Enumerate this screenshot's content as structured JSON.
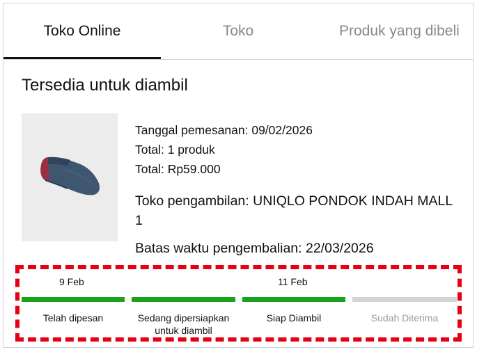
{
  "tabs": [
    {
      "label": "Toko Online",
      "active": true
    },
    {
      "label": "Toko",
      "active": false
    },
    {
      "label": "Produk yang dibeli",
      "active": false
    }
  ],
  "order": {
    "status_heading": "Tersedia untuk diambil",
    "product_image": "sock-product-image",
    "order_date": "Tanggal pemesanan: 09/02/2026",
    "total_items": "Total: 1 produk",
    "total_price": "Total: Rp59.000",
    "pickup_store": "Toko pengambilan: UNIQLO PONDOK INDAH MALL 1",
    "return_deadline": "Batas waktu pengembalian: 22/03/2026"
  },
  "progress": {
    "steps": [
      {
        "date": "9 Feb",
        "label": "Telah dipesan",
        "completed": true
      },
      {
        "date": "",
        "label": "Sedang dipersiapkan untuk diambil",
        "completed": true
      },
      {
        "date": "11 Feb",
        "label": "Siap Diambil",
        "completed": true
      },
      {
        "date": "",
        "label": "Sudah Diterima",
        "completed": false
      }
    ],
    "colors": {
      "completed": "#1aa31a",
      "pending": "#d4d4d4",
      "highlight": "#e60012"
    }
  }
}
